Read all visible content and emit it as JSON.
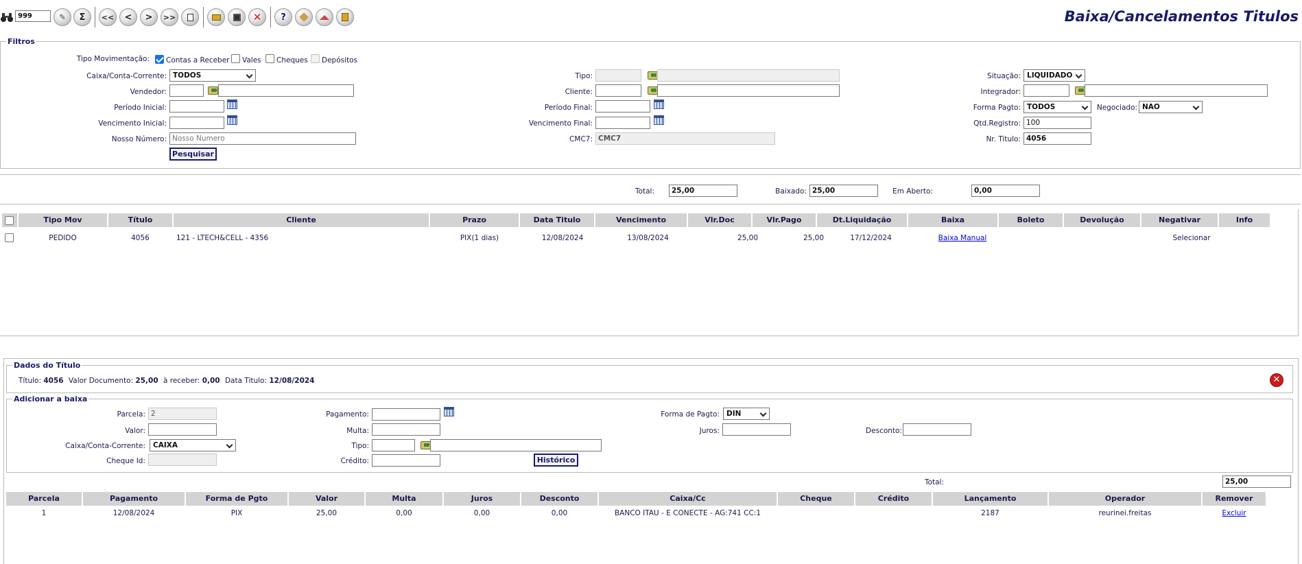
{
  "page": {
    "title": "Baixa/Cancelamentos Titulos"
  },
  "toolbar": {
    "record_count": "999",
    "buttons": [
      "find",
      "edit",
      "sum",
      "first",
      "previous",
      "next",
      "last",
      "new",
      "open",
      "save",
      "delete",
      "help",
      "tools",
      "home",
      "exit"
    ]
  },
  "filtros": {
    "legend": "Filtros",
    "tipo_movimentacao": {
      "label": "Tipo Movimentação:",
      "options": [
        {
          "label": "Contas a Receber",
          "checked": true,
          "disabled": false
        },
        {
          "label": "Vales",
          "checked": false,
          "disabled": false
        },
        {
          "label": "Cheques",
          "checked": false,
          "disabled": false
        },
        {
          "label": "Depósitos",
          "checked": false,
          "disabled": true
        }
      ]
    },
    "caixa_label": "Caixa/Conta-Corrente:",
    "caixa_value": "TODOS",
    "vendedor_label": "Vendedor:",
    "periodo_inicial_label": "Período Inicial:",
    "vencimento_inicial_label": "Vencimento Inicial:",
    "nosso_numero_label": "Nosso Número:",
    "nosso_numero_placeholder": "Nosso Numero",
    "pesquisar_button": "Pesquisar",
    "tipo_label": "Tipo:",
    "cliente_label": "Cliente:",
    "periodo_final_label": "Período Final:",
    "vencimento_final_label": "Vencimento Final:",
    "cmc7_label": "CMC7:",
    "cmc7_value": "CMC7",
    "situacao_label": "Situação:",
    "situacao_value": "LIQUIDADO",
    "integrador_label": "Integrador:",
    "forma_pagto_label": "Forma Pagto:",
    "forma_pagto_value": "TODOS",
    "negociado_label": "Negociado:",
    "negociado_value": "NAO",
    "qtd_registro_label": "Qtd.Registro:",
    "qtd_registro_value": "100",
    "nr_titulo_label": "Nr. Titulo:",
    "nr_titulo_value": "4056"
  },
  "totals": {
    "total_label": "Total:",
    "total_value": "25,00",
    "baixado_label": "Baixado:",
    "baixado_value": "25,00",
    "em_aberto_label": "Em Aberto:",
    "em_aberto_value": "0,00"
  },
  "titles_table": {
    "headers": [
      "Tipo Mov",
      "Título",
      "Cliente",
      "Prazo",
      "Data Titulo",
      "Vencimento",
      "Vlr.Doc",
      "Vlr.Pago",
      "Dt.Liquidação",
      "Baixa",
      "Boleto",
      "Devolução",
      "Negativar",
      "Info"
    ],
    "rows": [
      {
        "tipo_mov": "PEDIDO",
        "titulo": "4056",
        "cliente": "121 - LTECH&CELL - 4356",
        "prazo": "PIX(1 dias)",
        "data_titulo": "12/08/2024",
        "vencimento": "13/08/2024",
        "vlr_doc": "25,00",
        "vlr_pago": "25,00",
        "dt_liquidacao": "17/12/2024",
        "baixa": "Baixa Manual",
        "boleto": "",
        "devolucao": "",
        "negativar": "Selecionar",
        "info": ""
      }
    ]
  },
  "dados_titulo": {
    "legend": "Dados do Título",
    "titulo_label": "Título:",
    "titulo_value": "4056",
    "valor_documento_label": "Valor Documento:",
    "valor_documento_value": "25,00",
    "a_receber_label": "à receber:",
    "a_receber_value": "0,00",
    "data_titulo_label": "Data Titulo:",
    "data_titulo_value": "12/08/2024"
  },
  "adicionar_baixa": {
    "legend": "Adicionar a baixa",
    "parcela_label": "Parcela:",
    "parcela_value": "2",
    "valor_label": "Valor:",
    "caixa_label": "Caixa/Conta-Corrente:",
    "caixa_value": "CAIXA",
    "cheque_id_label": "Cheque Id:",
    "pagamento_label": "Pagamento:",
    "multa_label": "Multa:",
    "tipo_label": "Tipo:",
    "credito_label": "Crédito:",
    "historico_button": "Histórico",
    "forma_pagto_label": "Forma de Pagto:",
    "forma_pagto_value": "DIN",
    "juros_label": "Juros:",
    "desconto_label": "Desconto:"
  },
  "baixa_total": {
    "label": "Total:",
    "value": "25,00"
  },
  "baixas_table": {
    "headers": [
      "Parcela",
      "Pagamento",
      "Forma de Pgto",
      "Valor",
      "Multa",
      "Juros",
      "Desconto",
      "Caixa/Cc",
      "Cheque",
      "Crédito",
      "Lançamento",
      "Operador",
      "Remover"
    ],
    "rows": [
      {
        "parcela": "1",
        "pagamento": "12/08/2024",
        "forma_pgto": "PIX",
        "valor": "25,00",
        "multa": "0,00",
        "juros": "0,00",
        "desconto": "0,00",
        "caixa_cc": "BANCO ITAU - E CONECTE - AG:741 CC:1",
        "cheque": "",
        "credito": "",
        "lancamento": "2187",
        "operador": "reurinei.freitas",
        "remover": "Excluir"
      }
    ]
  },
  "colors": {
    "title": "#1a1a6a",
    "header_bg": "#d3d3d3",
    "link": "#0000ee",
    "close_icon": "#d01c1c",
    "checkbox_checked": "#1a73e8"
  }
}
